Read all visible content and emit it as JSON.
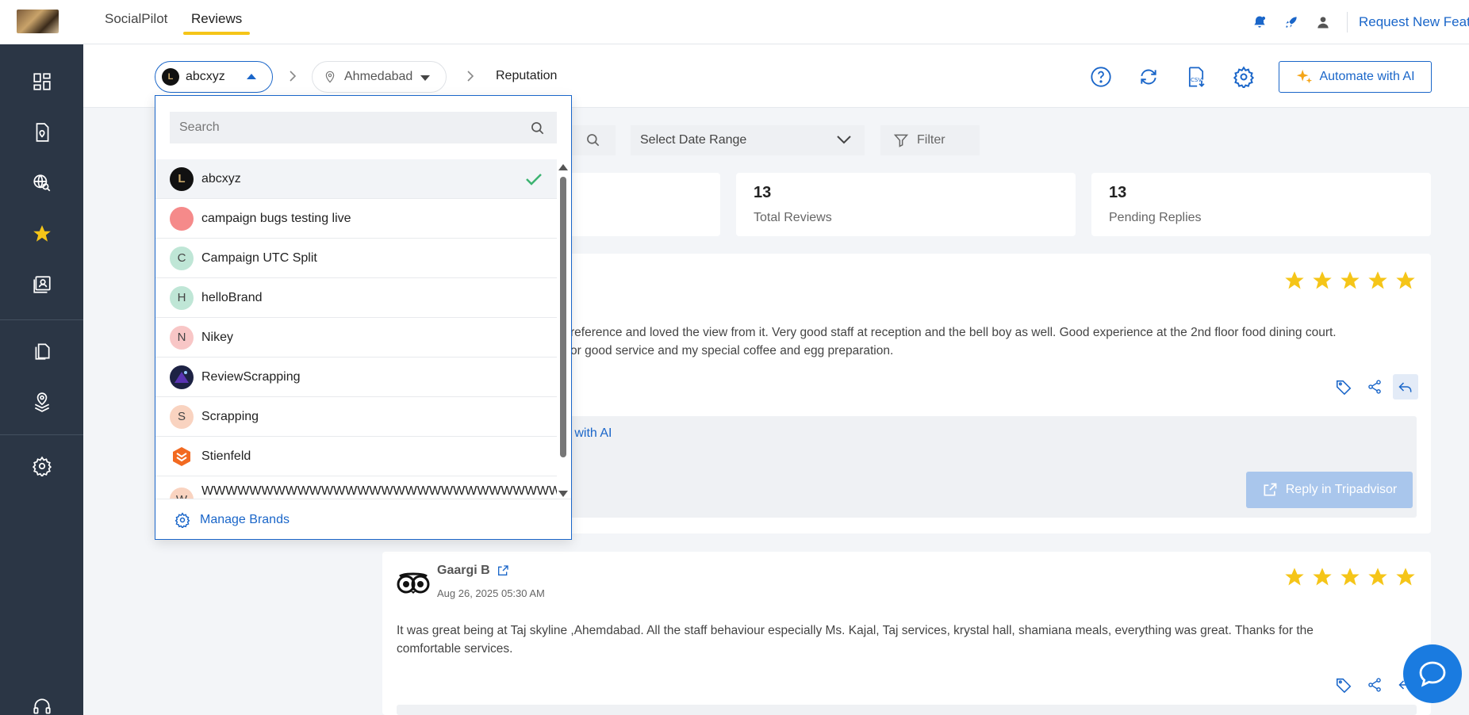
{
  "topbar": {
    "tabs": [
      {
        "label": "SocialPilot"
      },
      {
        "label": "Reviews"
      }
    ],
    "request_feature": "Request New Feature",
    "icons": [
      "notification-bell-icon",
      "rocket-icon",
      "user-icon"
    ]
  },
  "sidebar": {
    "items": [
      "dashboard-grid-icon",
      "document-location-icon",
      "globe-search-icon",
      "star-icon",
      "profile-card-icon",
      "copy-pages-icon",
      "location-layers-icon",
      "settings-gear-icon",
      "headset-icon"
    ],
    "active": "star-icon"
  },
  "header": {
    "brand": {
      "name": "abcxyz",
      "avatar": "L"
    },
    "location": "Ahmedabad",
    "current_page": "Reputation",
    "automate_label": "Automate with AI"
  },
  "filters": {
    "date_range_placeholder": "Select Date Range",
    "filter_label": "Filter"
  },
  "stats": [
    {
      "value": "13",
      "label": "Total Reviews"
    },
    {
      "value": "13",
      "label": "Pending Replies"
    }
  ],
  "reviews": [
    {
      "text_line1": "reference and loved the view from it. Very good staff at reception and the bell boy as well. Good experience at the 2nd floor food dining court.",
      "text_line2": "or good service and my special coffee and egg preparation.",
      "reply_ai_link": "e with AI",
      "reply_button": "Reply in Tripadvisor",
      "stars": 5
    },
    {
      "reviewer": "Gaargi B",
      "date": "Aug 26, 2025 05:30 AM",
      "text_line1": "It was great being at Taj skyline ,Ahemdabad. All the staff behaviour especially Ms. Kajal, Taj services, krystal hall, shamiana meals, everything was great. Thanks for the",
      "text_line2": "comfortable services.",
      "stars": 5
    }
  ],
  "brand_dropdown": {
    "search_placeholder": "Search",
    "items": [
      {
        "name": "abcxyz",
        "initial": "L",
        "color": "#111111",
        "selected": true
      },
      {
        "name": "campaign bugs testing live",
        "initial": "",
        "color": "#f58a8a",
        "selected": false
      },
      {
        "name": "Campaign UTC Split",
        "initial": "C",
        "color": "#bfe6d6",
        "selected": false
      },
      {
        "name": "helloBrand",
        "initial": "H",
        "color": "#bfe6d6",
        "selected": false
      },
      {
        "name": "Nikey",
        "initial": "N",
        "color": "#f8c6c6",
        "selected": false
      },
      {
        "name": "ReviewScrapping",
        "initial": "",
        "color": "#1d2244",
        "selected": false
      },
      {
        "name": "Scrapping",
        "initial": "S",
        "color": "#f9d3c0",
        "selected": false
      },
      {
        "name": "Stienfeld",
        "initial": "",
        "color": "#ffffff",
        "selected": false
      },
      {
        "name": "WWWWWWWWWWWWWWWWWWWWWWWWWWWWWW",
        "initial": "W",
        "color": "#f9d3c0",
        "selected": false
      }
    ],
    "manage_label": "Manage Brands"
  },
  "colors": {
    "accent": "#1a66c9",
    "star": "#f5c518",
    "sidebar": "#2b3645"
  }
}
